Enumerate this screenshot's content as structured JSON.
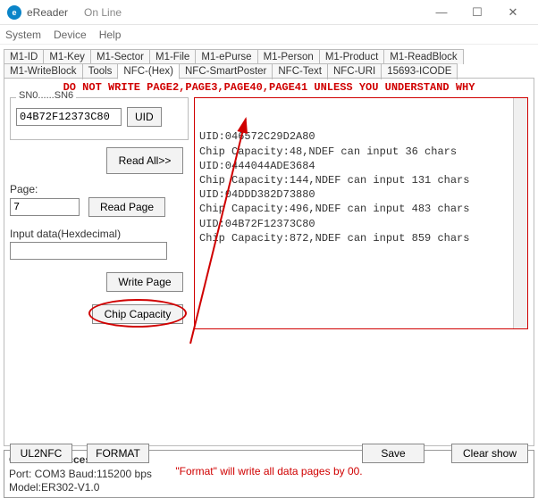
{
  "window": {
    "app_icon_letter": "e",
    "title": "eReader",
    "subtitle": "On Line",
    "min": "—",
    "max": "☐",
    "close": "✕"
  },
  "menu": {
    "system": "System",
    "device": "Device",
    "help": "Help"
  },
  "tabs": {
    "row1": [
      "M1-ID",
      "M1-Key",
      "M1-Sector",
      "M1-File",
      "M1-ePurse",
      "M1-Person",
      "M1-Product",
      "M1-ReadBlock"
    ],
    "row2": [
      "M1-WriteBlock",
      "Tools",
      "NFC-(Hex)",
      "NFC-SmartPoster",
      "NFC-Text",
      "NFC-URI",
      "15693-ICODE"
    ],
    "active": "NFC-(Hex)"
  },
  "warning": "DO NOT WRITE PAGE2,PAGE3,PAGE40,PAGE41 UNLESS YOU UNDERSTAND WHY",
  "sn": {
    "label": "SN0......SN6",
    "value": "04B72F12373C80",
    "uid_btn": "UID"
  },
  "buttons": {
    "read_all": "Read All>>",
    "read_page": "Read Page",
    "write_page": "Write Page",
    "chip_capacity": "Chip Capacity",
    "ul2nfc": "UL2NFC",
    "format": "FORMAT",
    "save": "Save",
    "clear_show": "Clear show"
  },
  "page": {
    "label": "Page:",
    "value": "7"
  },
  "inputdata": {
    "label": "Input data(Hexdecimal)",
    "value": ""
  },
  "output_lines": [
    "UID:046572C29D2A80",
    "Chip Capacity:48,NDEF can input 36 chars",
    "UID:0444044ADE3684",
    "Chip Capacity:144,NDEF can input 131 chars",
    "UID:04DDD382D73880",
    "Chip Capacity:496,NDEF can input 483 chars",
    "UID:04B72F12373C80",
    "Chip Capacity:872,NDEF can input 859 chars"
  ],
  "format_note": "\"Format\" will write all data pages by 00.",
  "status": {
    "line1": "Connect successful!",
    "line2": "Port: COM3 Baud:115200 bps",
    "line3": "Model:ER302-V1.0"
  }
}
